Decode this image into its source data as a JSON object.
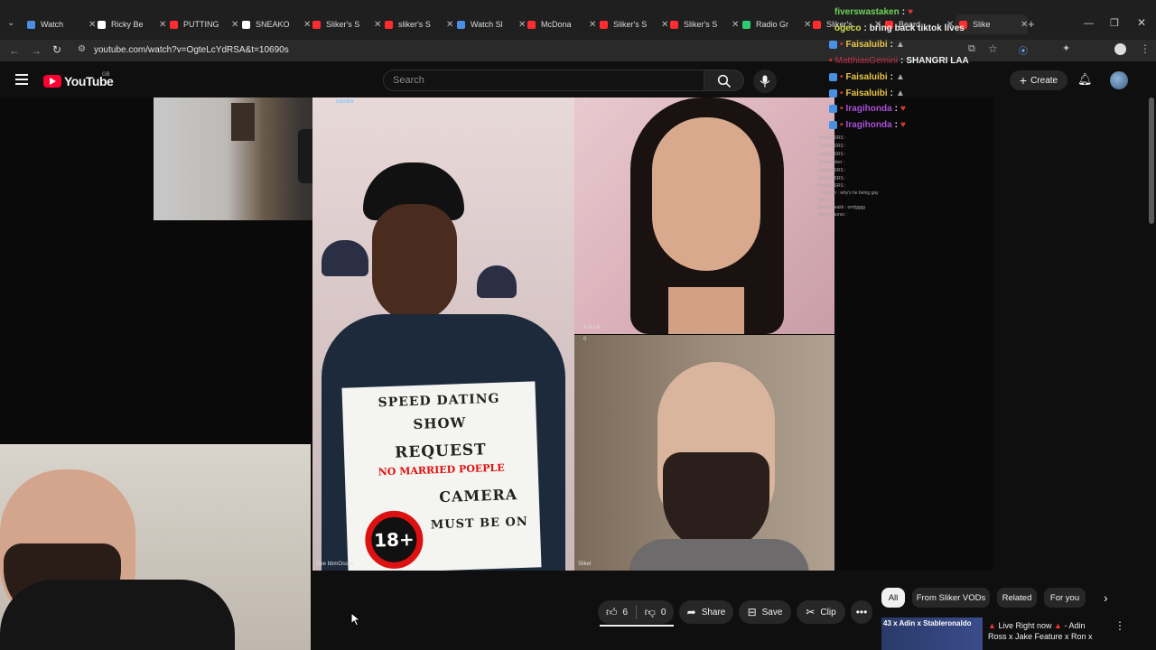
{
  "browser": {
    "tabs": [
      {
        "label": "Watch",
        "color": "#4a90e2"
      },
      {
        "label": "Ricky Be",
        "color": "#ffffff"
      },
      {
        "label": "PUTTING",
        "color": "#ff2d2d"
      },
      {
        "label": "SNEAKO",
        "color": "#ffffff"
      },
      {
        "label": "Sliker's S",
        "color": "#ff2d2d"
      },
      {
        "label": "sliker's S",
        "color": "#ff2d2d"
      },
      {
        "label": "Watch Sl",
        "color": "#4a90e2"
      },
      {
        "label": "McDona",
        "color": "#ff2d2d"
      },
      {
        "label": "Sliker's S",
        "color": "#ff2d2d"
      },
      {
        "label": "Sliker's S",
        "color": "#ff2d2d"
      },
      {
        "label": "Radio Gr",
        "color": "#2ecc71"
      },
      {
        "label": "Sliker's",
        "color": "#ff2d2d"
      },
      {
        "label": "Beard",
        "color": "#ff2d2d"
      },
      {
        "label": "Slike",
        "color": "#ff2d2d"
      }
    ],
    "url": "youtube.com/watch?v=OgteLcYdRSA&t=10690s"
  },
  "youtube": {
    "logo_text": "YouTube",
    "region": "GB",
    "search_placeholder": "Search",
    "create_label": "Create"
  },
  "video": {
    "sign_lines": [
      "SPEED DATING",
      "SHOW",
      "REQUEST",
      "NO MARRIED POEPLE",
      "CAMERA",
      "MUST BE ON",
      "18+"
    ],
    "caption_left": "Dee bbmOssce",
    "caption_right": "Sliker",
    "count_top": "20",
    "count_bottom": "0",
    "caption_tl": "monitor",
    "caption_girl": "A N I A"
  },
  "chat": [
    {
      "user": "fiverswastaken",
      "msg": "",
      "color": "#6fd45b"
    },
    {
      "user": "ogeco",
      "msg": "bring back tiktok lives",
      "color": "#d6e04a"
    },
    {
      "user": "Faisaluibi",
      "msg": "",
      "color": "#e8c547"
    },
    {
      "user": "MatthiasGemini",
      "msg": "SHANGRI LAA",
      "color": "#c0304a"
    },
    {
      "user": "Faisaluibi",
      "msg": "",
      "color": "#e8c547"
    },
    {
      "user": "Faisaluibi",
      "msg": "",
      "color": "#e8c547"
    },
    {
      "user": "Iragihonda",
      "msg": "",
      "color": "#a94fd6"
    },
    {
      "user": "Iragihonda",
      "msg": "",
      "color": "#a94fd6"
    }
  ],
  "chat_small": [
    "VanityOSRS :",
    "VanityOSRS :",
    "VanityOSRS :",
    "Kreamlikker :",
    "VanityOSRS :",
    "VanityOSRS :",
    "VanityOSRS :",
    "Gutsen : why's he being gay",
    "lush2 :",
    "Kreamfreakk : omfgggg",
    "deesonaurus :"
  ],
  "actions": {
    "likes": "6",
    "dislikes": "0",
    "share": "Share",
    "save": "Save",
    "clip": "Clip"
  },
  "chips": [
    "All",
    "From Sliker VODs",
    "Related",
    "For you"
  ],
  "recommended": {
    "title_line1": "Live Right now",
    "title_line1b": "- Adin",
    "title_line2": "Ross x Jake Feature x Ron x",
    "thumb_text": "43 x Adin x Stableronaldo"
  }
}
